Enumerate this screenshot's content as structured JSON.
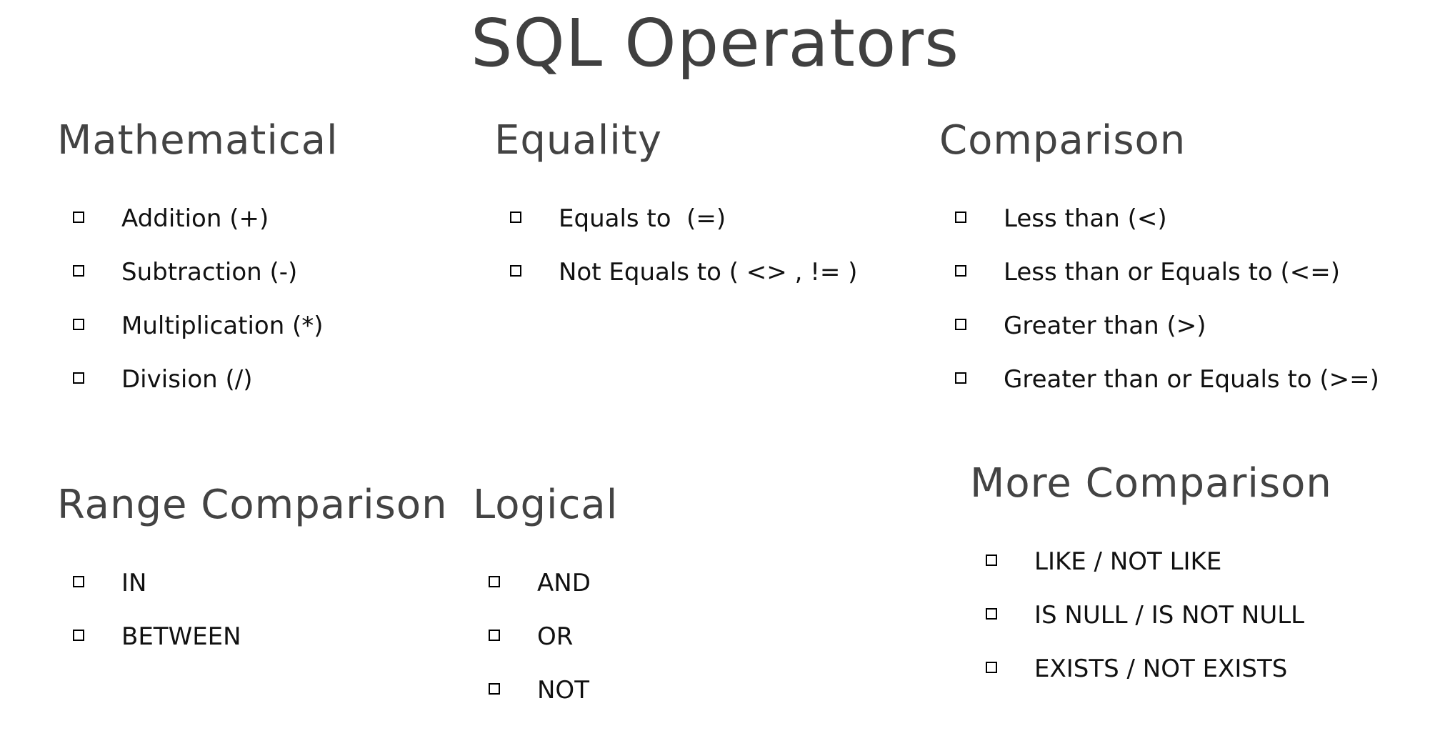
{
  "title": "SQL Operators",
  "sections": {
    "mathematical": {
      "heading": "Mathematical",
      "items": [
        "Addition (+)",
        "Subtraction (-)",
        "Multiplication (*)",
        "Division (/)"
      ]
    },
    "equality": {
      "heading": "Equality",
      "items": [
        "Equals to  (=)",
        "Not Equals to ( <> , != )"
      ]
    },
    "comparison": {
      "heading": "Comparison",
      "items": [
        "Less than (<)",
        "Less than or Equals to (<=)",
        "Greater than (>)",
        "Greater than or Equals to (>=)"
      ]
    },
    "range_comparison": {
      "heading": "Range Comparison",
      "items": [
        "IN",
        "BETWEEN"
      ]
    },
    "logical": {
      "heading": "Logical",
      "items": [
        "AND",
        "OR",
        "NOT"
      ]
    },
    "more_comparison": {
      "heading": "More Comparison",
      "items": [
        "LIKE / NOT LIKE",
        "IS NULL / IS NOT NULL",
        "EXISTS / NOT EXISTS"
      ]
    }
  },
  "icons": {
    "bullet": "shadowed-checkbox-icon"
  },
  "colors": {
    "heading": "#434343",
    "text": "#111111",
    "background": "#ffffff"
  }
}
